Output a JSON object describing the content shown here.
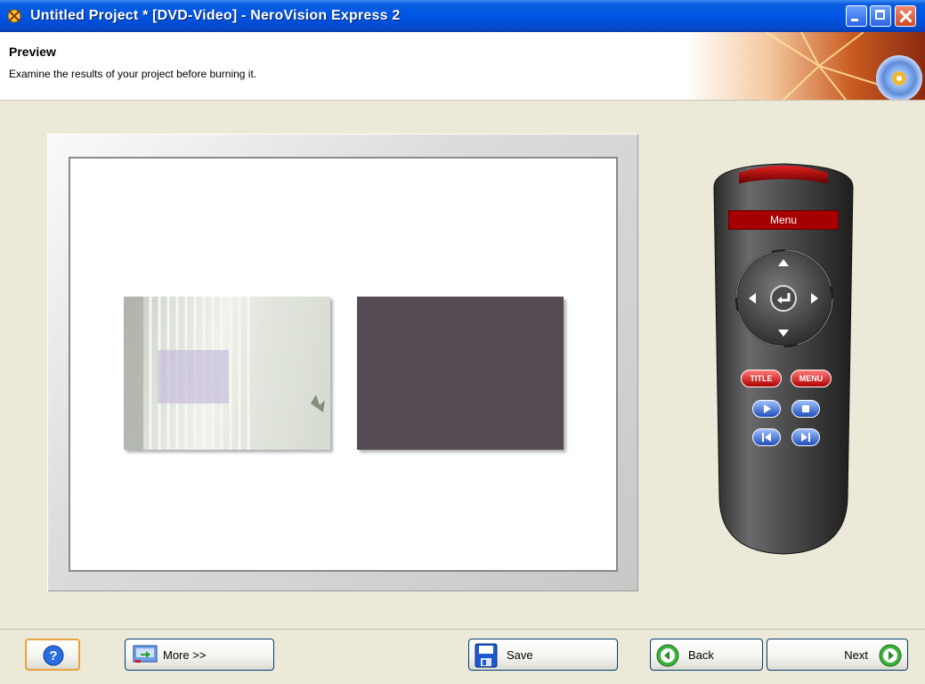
{
  "window": {
    "title": "Untitled Project * [DVD-Video] - NeroVision Express 2"
  },
  "header": {
    "title": "Preview",
    "subtitle": "Examine the results of your project before burning it."
  },
  "remote": {
    "display_label": "Menu",
    "title_button": "TITLE",
    "menu_button": "MENU"
  },
  "buttons": {
    "more": "More >>",
    "save": "Save",
    "back": "Back",
    "next": "Next"
  },
  "icons": {
    "help": "help-icon",
    "more": "more-options-icon",
    "save": "floppy-disk-icon",
    "back": "back-arrow-icon",
    "next": "next-arrow-icon"
  }
}
